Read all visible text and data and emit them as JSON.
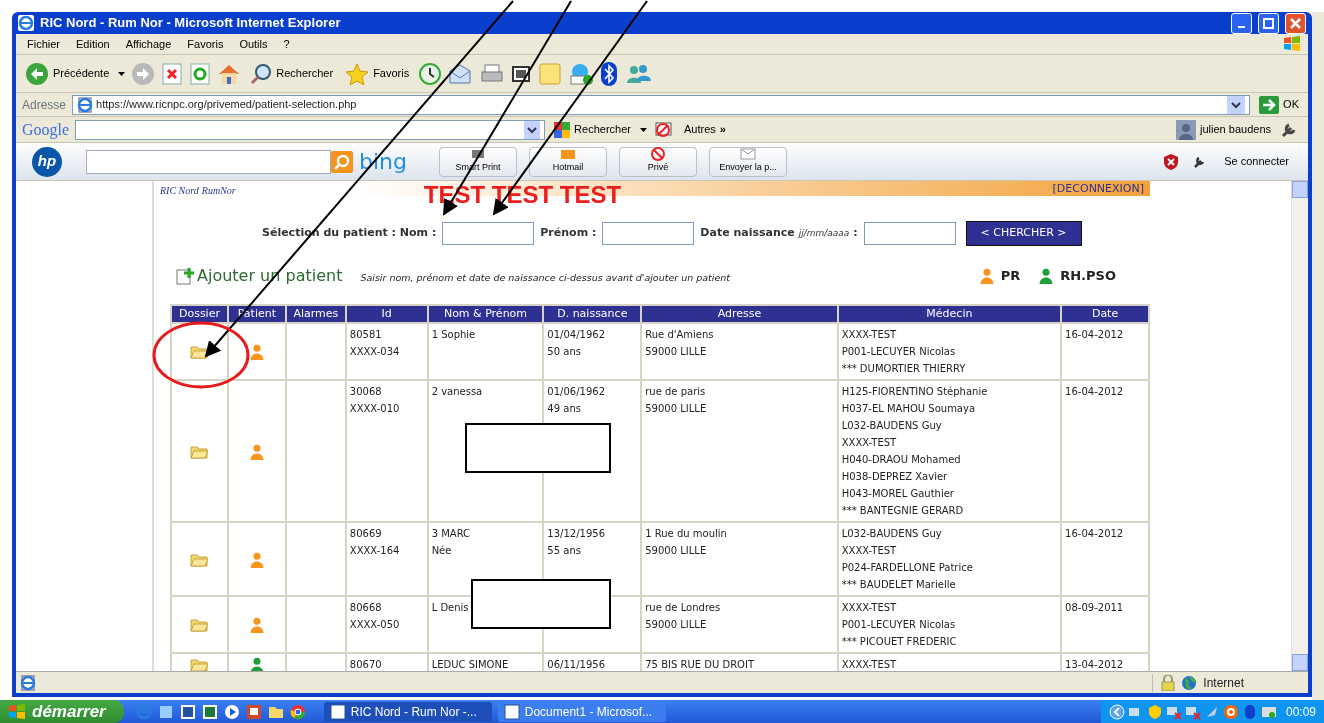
{
  "window": {
    "title": "RIC Nord - Rum Nor - Microsoft Internet Explorer"
  },
  "menu": [
    "Fichier",
    "Edition",
    "Affichage",
    "Favoris",
    "Outils",
    "?"
  ],
  "toolbar": {
    "back": "Précédente",
    "search": "Rechercher",
    "favorites": "Favoris"
  },
  "address": {
    "label": "Adresse",
    "url": "https://www.ricnpc.org/privemed/patient-selection.php",
    "go": "OK"
  },
  "google_bar": {
    "logo": "Google",
    "search_button": "Rechercher",
    "more": "Autres",
    "more_mark": "»",
    "user": "julien baudens"
  },
  "hp_bar": {
    "logo": "hp",
    "bing": "bing",
    "buttons": [
      "Smart Print",
      "Hotmail",
      "Privé",
      "Envoyer la p..."
    ],
    "sign_in": "Se connecter"
  },
  "page": {
    "logos": [
      "RIC Nord",
      "RumNor"
    ],
    "logout": "[DECONNEXION]",
    "banner": "TEST TEST TEST",
    "search": {
      "name_label": "Sélection du patient : Nom :",
      "first_label": "Prénom :",
      "dob_label": "Date naissance",
      "dob_hint": "jj/mm/aaaa",
      "dob_colon": ":",
      "button": "< CHERCHER >"
    },
    "add": "Ajouter un patient",
    "hint": "Saisir nom, prénom et date de naissance ci-dessus avant d'ajouter un patient",
    "legend": [
      {
        "label": "PR",
        "color": "#f7941d"
      },
      {
        "label": "RH.PSO",
        "color": "#1f9e3a"
      }
    ]
  },
  "table": {
    "columns": [
      "Dossier",
      "Patient",
      "Alarmes",
      "Id",
      "Nom & Prénom",
      "D. naissance",
      "Adresse",
      "Médecin",
      "Date"
    ],
    "rows": [
      {
        "color": "#f7941d",
        "id": [
          "80581",
          "XXXX-034"
        ],
        "name": [
          "1 Sophie"
        ],
        "birth": [
          "01/04/1962",
          "50 ans"
        ],
        "address": [
          "Rue d'Amiens",
          "59000 LILLE"
        ],
        "doctors": [
          "XXXX-TEST",
          "P001-LECUYER Nicolas",
          "*** DUMORTIER THIERRY"
        ],
        "date": "16-04-2012"
      },
      {
        "color": "#f7941d",
        "id": [
          "30068",
          "XXXX-010"
        ],
        "name": [
          "2 vanessa"
        ],
        "birth": [
          "01/06/1962",
          "49 ans"
        ],
        "address": [
          "rue de paris",
          "59000 LILLE"
        ],
        "doctors": [
          "H125-FIORENTINO Stéphanie",
          "H037-EL MAHOU Soumaya",
          "L032-BAUDENS Guy",
          "XXXX-TEST",
          "H040-DRAOU Mohamed",
          "H038-DEPREZ Xavier",
          "H043-MOREL Gauthier",
          "*** BANTEGNIE GERARD"
        ],
        "date": "16-04-2012"
      },
      {
        "color": "#f7941d",
        "id": [
          "80669",
          "XXXX-164"
        ],
        "name": [
          "3 MARC",
          "Née"
        ],
        "birth": [
          "13/12/1956",
          "55 ans"
        ],
        "address": [
          "1 Rue du moulin",
          "59000 LILLE"
        ],
        "doctors": [
          "L032-BAUDENS Guy",
          "XXXX-TEST",
          "P024-FARDELLONE Patrice",
          "*** BAUDELET Marielle"
        ],
        "date": "16-04-2012"
      },
      {
        "color": "#f7941d",
        "id": [
          "80668",
          "XXXX-050"
        ],
        "name": [
          "L Denis"
        ],
        "address": [
          "rue de Londres",
          "59000 LILLE"
        ],
        "doctors": [
          "XXXX-TEST",
          "P001-LECUYER Nicolas",
          "*** PICOUET FREDERIC"
        ],
        "date": "08-09-2011"
      },
      {
        "color": "#1f9e3a",
        "id": [
          "80670"
        ],
        "name": [
          "LEDUC SIMONE"
        ],
        "birth": [
          "06/11/1956"
        ],
        "address": [
          "75 BIS RUE DU DROIT"
        ],
        "doctors": [
          "XXXX-TEST"
        ],
        "date": "13-04-2012"
      }
    ]
  },
  "status_bar": {
    "zone": "Internet"
  },
  "taskbar": {
    "start": "démarrer",
    "tasks": [
      {
        "label": "RIC Nord - Rum Nor -...",
        "selected": true
      },
      {
        "label": "Document1 - Microsof...",
        "selected": false
      }
    ],
    "clock": "00:09"
  }
}
